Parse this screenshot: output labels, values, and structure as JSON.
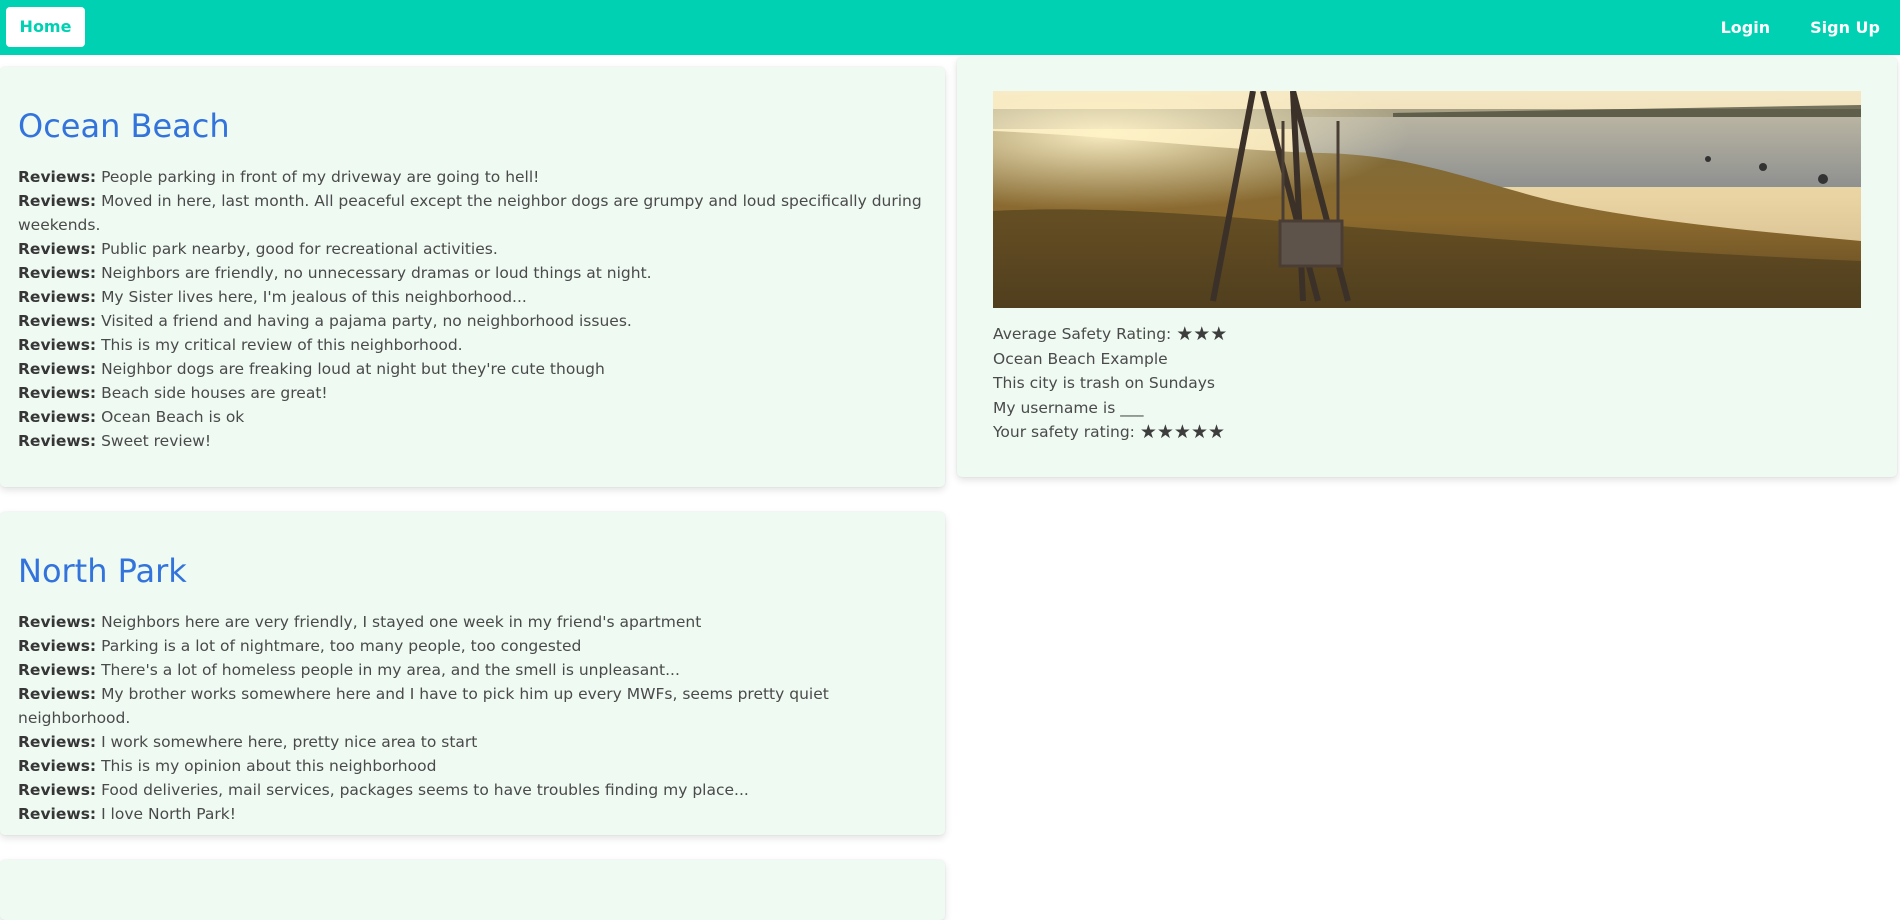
{
  "nav": {
    "home_label": "Home",
    "login_label": "Login",
    "signup_label": "Sign Up"
  },
  "neighborhoods": [
    {
      "name": "Ocean Beach",
      "review_label": "Reviews:",
      "reviews": [
        "People parking in front of my driveway are going to hell!",
        "Moved in here, last month. All peaceful except the neighbor dogs are grumpy and loud specifically during weekends.",
        "Public park nearby, good for recreational activities.",
        "Neighbors are friendly, no unnecessary dramas or loud things at night.",
        "My Sister lives here, I'm jealous of this neighborhood...",
        "Visited a friend and having a pajama party, no neighborhood issues.",
        "This is my critical review of this neighborhood.",
        "Neighbor dogs are freaking loud at night but they're cute though",
        "Beach side houses are great!",
        "Ocean Beach is ok",
        "Sweet review!"
      ]
    },
    {
      "name": "North Park",
      "review_label": "Reviews:",
      "reviews": [
        "Neighbors here are very friendly, I stayed one week in my friend's apartment",
        "Parking is a lot of nightmare, too many people, too congested",
        "There's a lot of homeless people in my area, and the smell is unpleasant...",
        "My brother works somewhere here and I have to pick him up every MWFs, seems pretty quiet neighborhood.",
        "I work somewhere here, pretty nice area to start",
        "This is my opinion about this neighborhood",
        "Food deliveries, mail services, packages seems to have troubles finding my place...",
        "I love North Park!"
      ]
    }
  ],
  "detail": {
    "avg_rating_label": "Average Safety Rating:",
    "avg_rating_stars": "★★★",
    "avg_rating": 3,
    "name_line": "Ocean Beach Example",
    "description": "This city is trash on Sundays",
    "username_line": "My username is ___",
    "your_rating_label": "Your safety rating:",
    "your_rating_stars": "★★★★★",
    "your_rating": 5
  },
  "colors": {
    "brand": "#00d1b2",
    "title": "#3273dc",
    "card_bg": "#effaf3"
  }
}
